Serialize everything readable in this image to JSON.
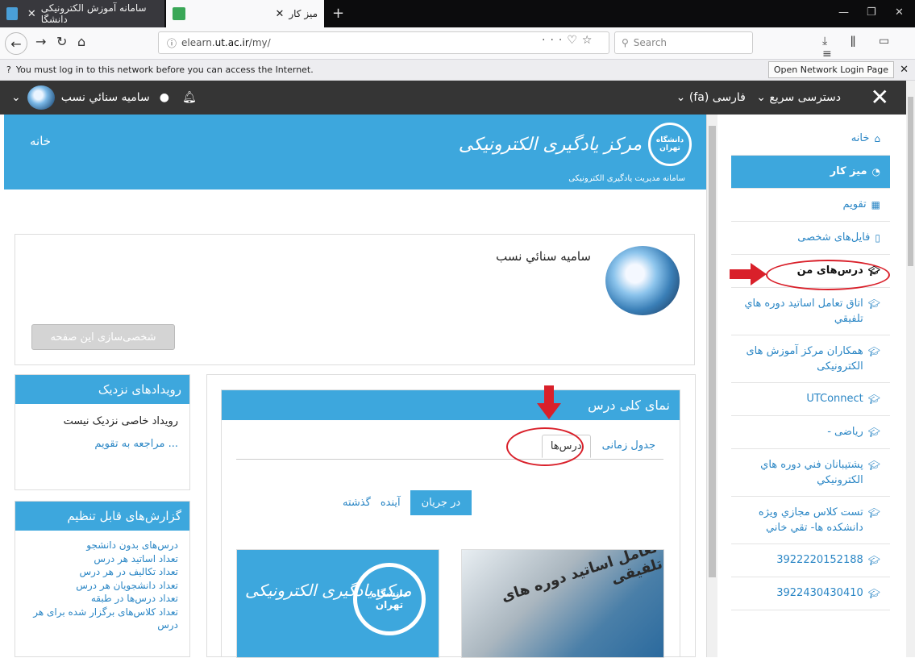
{
  "browser": {
    "tabs": [
      {
        "label": "سامانه آموزش الکترونیکی دانشگا",
        "active": false
      },
      {
        "label": "میز کار",
        "active": true
      }
    ],
    "url_prefix": "elearn.",
    "url_domain": "ut.ac.ir",
    "url_path": "/my/",
    "search_placeholder": "Search",
    "notification": "You must log in to this network before you can access the Internet.",
    "notification_button": "Open Network Login Page"
  },
  "site_nav": {
    "user_name": "سامیه سنائي نسب",
    "language_menu": "فارسی (fa)",
    "quick_access_menu": "دسترسی سریع"
  },
  "banner": {
    "home_link": "خانه",
    "logo_title": "مرکز یادگیری الکترونیکی",
    "logo_seal": "دانشگاه تهران",
    "logo_subtitle": "سامانه مدیریت یادگیری الکترونیکی"
  },
  "profile": {
    "name": "سامیه سنائي نسب",
    "customize_button": "شخصی‌سازی این صفحه"
  },
  "drawer": {
    "items": [
      {
        "label": "خانه",
        "icon": "home-icon"
      },
      {
        "label": "میز کار",
        "icon": "dashboard-icon",
        "active": true
      },
      {
        "label": "تقویم",
        "icon": "calendar-icon"
      },
      {
        "label": "فایل‌های شخصی",
        "icon": "file-icon"
      },
      {
        "label": "درس‌های من",
        "icon": "graduation-cap-icon"
      },
      {
        "label": "اتاق تعامل اساتید دوره هاي تلفيقي",
        "icon": "graduation-cap-icon"
      },
      {
        "label": "همکاران مرکز آموزش های الکترونیکی",
        "icon": "graduation-cap-icon"
      },
      {
        "label": "UTConnect",
        "icon": "graduation-cap-icon"
      },
      {
        "label": "ریاضی -",
        "icon": "graduation-cap-icon"
      },
      {
        "label": "پشتيبانان فني دوره هاي الکترونيکي",
        "icon": "graduation-cap-icon"
      },
      {
        "label": "تست کلاس مجازي ويژه دانشکده ها- تقي خاني",
        "icon": "graduation-cap-icon"
      },
      {
        "label": "3922220152188",
        "icon": "graduation-cap-icon"
      },
      {
        "label": "3922430430410",
        "icon": "graduation-cap-icon"
      }
    ]
  },
  "events_block": {
    "title": "رویدادهای نزدیک",
    "empty_text": "رویداد خاصی نزدیک نیست",
    "calendar_link": "... مراجعه به تقویم"
  },
  "reports_block": {
    "title": "گزارش‌های قابل تنظیم",
    "items": [
      "درس‌های بدون دانشجو",
      "تعداد اساتید هر درس",
      "تعداد تکالیف در هر درس",
      "تعداد دانشجويان هر درس",
      "تعداد درس‌ها در طبقه",
      "تعداد کلاس‌های برگزار شده برای هر درس"
    ]
  },
  "course_overview": {
    "title": "نمای کلی درس",
    "tabs": {
      "timeline": "جدول زمانی",
      "courses": "درس‌ها"
    },
    "status": {
      "in_progress": "در جریان",
      "future": "آینده",
      "past": "گذشته"
    },
    "course_card_1_text": "تعامل اساتید دوره های تلفیقی",
    "course_card_2_title": "مرکز یادگیری الکترونیکی",
    "course_card_2_seal": "دانشگاه تهران"
  },
  "colors": {
    "accent": "#3da7dd",
    "link": "#2a86c5",
    "annotation": "#d9202a",
    "navbar": "#353535"
  }
}
